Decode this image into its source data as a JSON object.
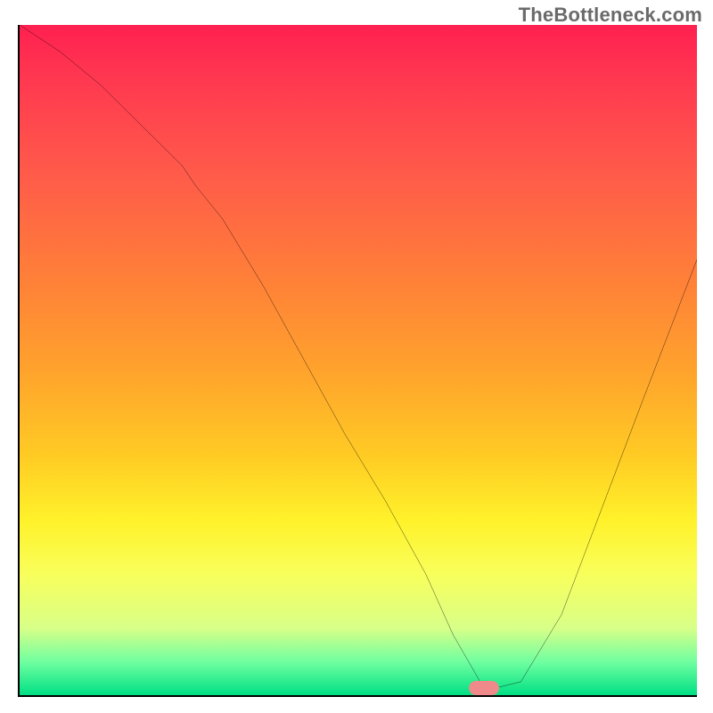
{
  "watermark": "TheBottleneck.com",
  "chart_data": {
    "type": "line",
    "title": "",
    "xlabel": "",
    "ylabel": "",
    "xlim": [
      0,
      100
    ],
    "ylim": [
      0,
      100
    ],
    "series": [
      {
        "name": "bottleneck-curve",
        "x": [
          0,
          6,
          12,
          18,
          24,
          26,
          30,
          36,
          42,
          48,
          54,
          60,
          64,
          68,
          70,
          74,
          80,
          86,
          92,
          100
        ],
        "y": [
          100,
          96,
          91,
          85,
          79,
          76,
          71,
          61,
          50,
          39,
          29,
          18,
          9,
          2,
          1,
          2,
          12,
          28,
          44,
          65
        ]
      }
    ],
    "marker": {
      "x": 68.5,
      "y": 1,
      "shape": "pill",
      "color": "#f08a8a"
    },
    "background_gradient": {
      "stops": [
        {
          "pos": 0.0,
          "color": "#ff2050"
        },
        {
          "pos": 0.08,
          "color": "#ff3850"
        },
        {
          "pos": 0.22,
          "color": "#ff5a4a"
        },
        {
          "pos": 0.38,
          "color": "#ff8038"
        },
        {
          "pos": 0.52,
          "color": "#ffa42c"
        },
        {
          "pos": 0.64,
          "color": "#ffca24"
        },
        {
          "pos": 0.74,
          "color": "#fff22a"
        },
        {
          "pos": 0.82,
          "color": "#f8ff5c"
        },
        {
          "pos": 0.9,
          "color": "#d8ff88"
        },
        {
          "pos": 0.95,
          "color": "#70ffa0"
        },
        {
          "pos": 1.0,
          "color": "#00e084"
        }
      ]
    }
  }
}
